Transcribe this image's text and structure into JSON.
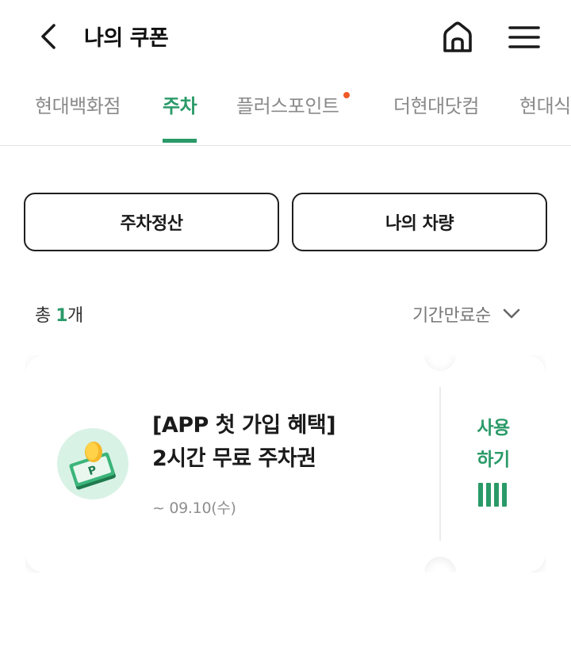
{
  "header": {
    "title": "나의 쿠폰"
  },
  "tabs": [
    {
      "label": "현대백화점",
      "active": false
    },
    {
      "label": "주차",
      "active": true
    },
    {
      "label": "플러스포인트",
      "active": false,
      "has_dot": true
    },
    {
      "label": "더현대닷컴",
      "active": false
    },
    {
      "label": "현대식",
      "active": false
    }
  ],
  "actions": {
    "parking_payment": "주차정산",
    "my_vehicle": "나의 차량"
  },
  "list": {
    "count_prefix": "총 ",
    "count_value": "1",
    "count_suffix": "개",
    "sort_label": "기간만료순"
  },
  "coupons": [
    {
      "title_line1": "[APP 첫 가입 혜택]",
      "title_line2": "2시간 무료 주차권",
      "date": "~ 09.10(수)",
      "use_line1": "사용",
      "use_line2": "하기"
    }
  ],
  "colors": {
    "accent": "#2a9a68",
    "notification_dot": "#f05a28",
    "border_dark": "#1f1f1f"
  },
  "icons": {
    "back": "chevron-left-icon",
    "home": "home-icon",
    "menu": "hamburger-menu-icon",
    "sort": "chevron-down-icon",
    "coupon": "parking-coin-icon",
    "barcode": "barcode-icon"
  }
}
